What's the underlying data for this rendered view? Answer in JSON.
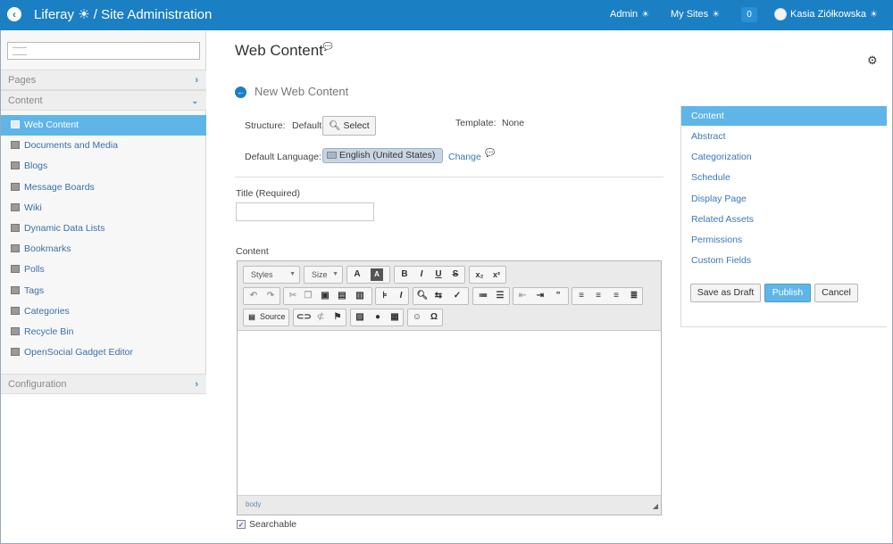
{
  "topbar": {
    "title": "Liferay ☀ / Site Administration",
    "admin": "Admin",
    "my_sites": "My Sites",
    "notifications": "0",
    "user": "Kasia Ziółkowska"
  },
  "sidebar": {
    "sections": {
      "pages": "Pages",
      "content": "Content",
      "configuration": "Configuration"
    },
    "items": [
      {
        "label": "Web Content",
        "icon": "web-content-icon",
        "active": true
      },
      {
        "label": "Documents and Media",
        "icon": "documents-icon"
      },
      {
        "label": "Blogs",
        "icon": "blogs-icon"
      },
      {
        "label": "Message Boards",
        "icon": "message-boards-icon"
      },
      {
        "label": "Wiki",
        "icon": "wiki-icon"
      },
      {
        "label": "Dynamic Data Lists",
        "icon": "ddl-icon"
      },
      {
        "label": "Bookmarks",
        "icon": "bookmarks-icon"
      },
      {
        "label": "Polls",
        "icon": "polls-icon"
      },
      {
        "label": "Tags",
        "icon": "tags-icon"
      },
      {
        "label": "Categories",
        "icon": "categories-icon"
      },
      {
        "label": "Recycle Bin",
        "icon": "trash-icon"
      },
      {
        "label": "OpenSocial Gadget Editor",
        "icon": "gadget-icon"
      }
    ]
  },
  "main": {
    "page_title": "Web Content",
    "sub_title": "New Web Content",
    "structure_label": "Structure:",
    "structure_value": "Default",
    "select_button": "Select",
    "template_label": "Template:",
    "template_value": "None",
    "default_language_label": "Default Language:",
    "default_language_value": "English (United States)",
    "change_link": "Change",
    "title_label": "Title (Required)",
    "title_value": "",
    "content_label": "Content",
    "editor": {
      "styles_combo": "Styles",
      "size_combo": "Size",
      "source_button": "Source",
      "statusbar_path": "body"
    },
    "searchable_label": "Searchable",
    "searchable_checked": true
  },
  "right_panel": {
    "items": [
      "Content",
      "Abstract",
      "Categorization",
      "Schedule",
      "Display Page",
      "Related Assets",
      "Permissions",
      "Custom Fields"
    ],
    "active_item": "Content",
    "save_draft": "Save as Draft",
    "publish": "Publish",
    "cancel": "Cancel"
  },
  "colors": {
    "brand_blue": "#1b7fc4",
    "active_highlight": "#5fb5e8",
    "link": "#3a78b8"
  }
}
